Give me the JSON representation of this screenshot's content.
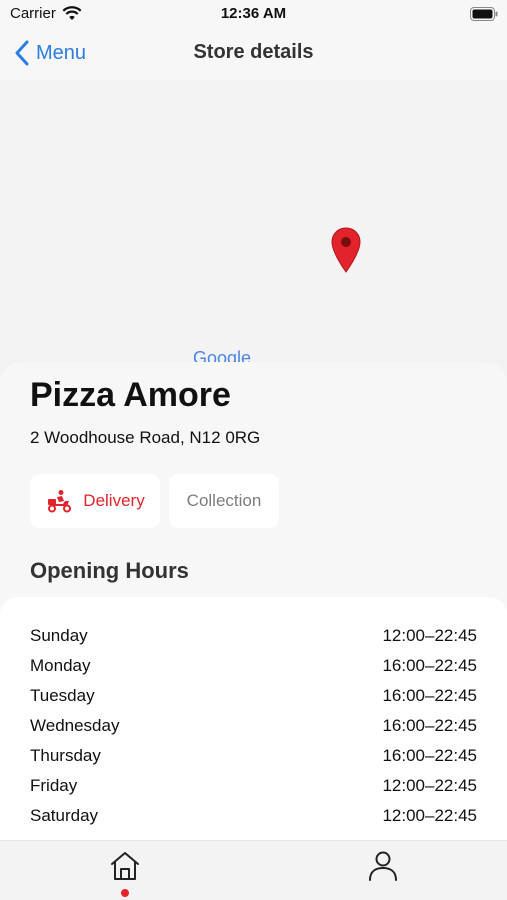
{
  "status_bar": {
    "carrier": "Carrier",
    "time": "12:36 AM"
  },
  "nav": {
    "back_label": "Menu",
    "title": "Store details"
  },
  "map": {
    "logo_text": "Google",
    "pin_color": "#e2232b"
  },
  "store": {
    "name": "Pizza Amore",
    "address": "2 Woodhouse Road, N12 0RG"
  },
  "order_options": [
    {
      "label": "Delivery",
      "selected": true
    },
    {
      "label": "Collection",
      "selected": false
    }
  ],
  "opening_hours": {
    "heading": "Opening Hours",
    "days": [
      {
        "day": "Sunday",
        "hours": "12:00–22:45"
      },
      {
        "day": "Monday",
        "hours": "16:00–22:45"
      },
      {
        "day": "Tuesday",
        "hours": "16:00–22:45"
      },
      {
        "day": "Wednesday",
        "hours": "16:00–22:45"
      },
      {
        "day": "Thursday",
        "hours": "16:00–22:45"
      },
      {
        "day": "Friday",
        "hours": "12:00–22:45"
      },
      {
        "day": "Saturday",
        "hours": "12:00–22:45"
      }
    ]
  },
  "tab_bar": {
    "tabs": [
      {
        "icon": "home-icon",
        "active": true
      },
      {
        "icon": "profile-icon",
        "active": false
      }
    ]
  },
  "colors": {
    "accent": "#e2232b",
    "link": "#2a7de1"
  }
}
